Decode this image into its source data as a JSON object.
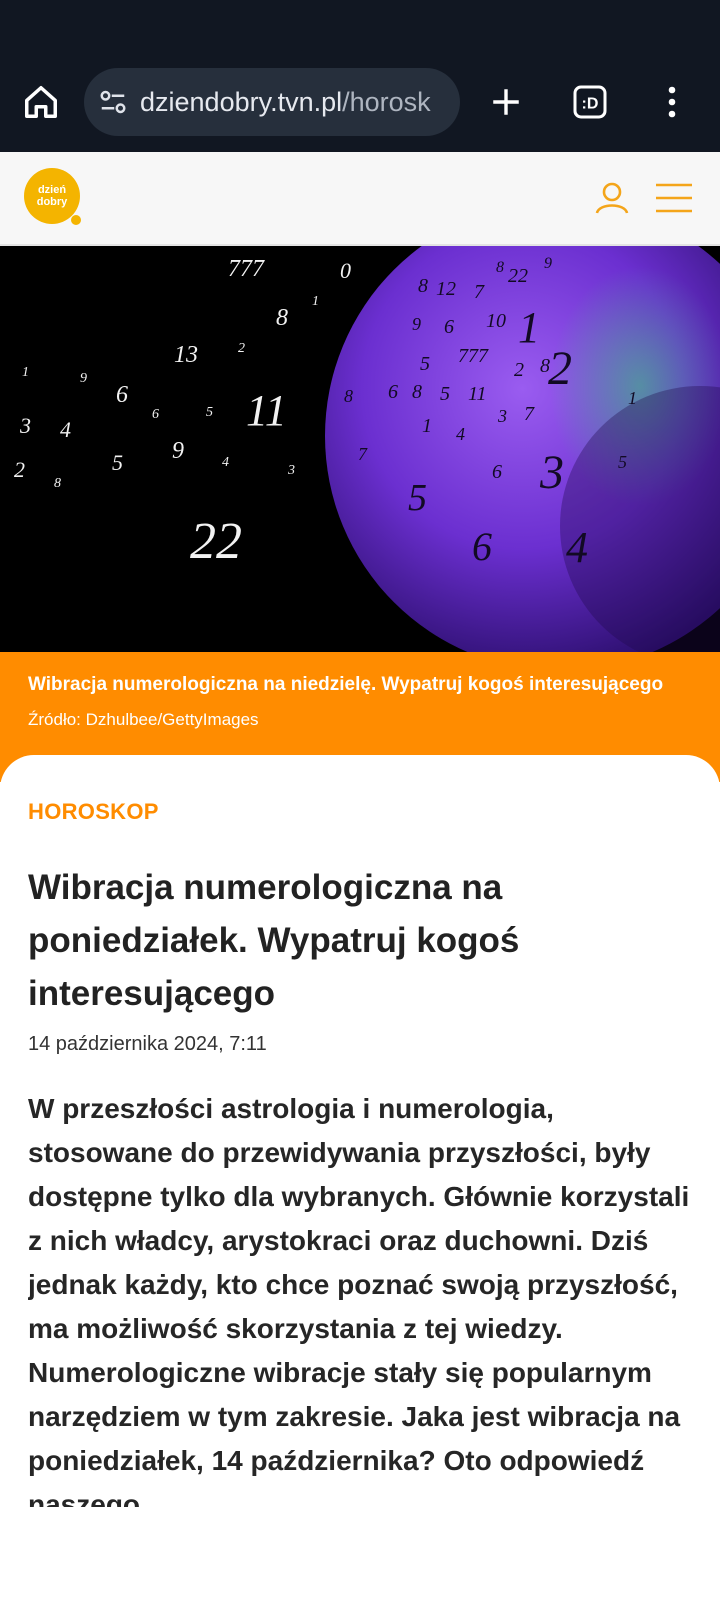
{
  "browser": {
    "url_domain": "dziendobry.tvn.pl",
    "url_path": "/horosk",
    "tab_badge": ":D"
  },
  "site": {
    "logo_line1": "dzień",
    "logo_line2": "dobry",
    "accent_color": "#ff8c00",
    "logo_color": "#f4b400"
  },
  "hero": {
    "numbers": [
      "777",
      "0",
      "8",
      "1",
      "2",
      "13",
      "1",
      "9",
      "6",
      "6",
      "5",
      "11",
      "3",
      "4",
      "2",
      "8",
      "5",
      "9",
      "4",
      "3",
      "22",
      "8",
      "12",
      "7",
      "8",
      "22",
      "9",
      "9",
      "6",
      "10",
      "1",
      "5",
      "777",
      "2",
      "8",
      "2",
      "8",
      "6",
      "8",
      "5",
      "11",
      "3",
      "7",
      "1",
      "1",
      "4",
      "7",
      "6",
      "3",
      "5",
      "6",
      "5",
      "4"
    ]
  },
  "caption": {
    "title": "Wibracja numerologiczna na niedzielę. Wypatruj kogoś interesującego",
    "source": "Źródło: Dzhulbee/GettyImages"
  },
  "article": {
    "category": "HOROSKOP",
    "headline": "Wibracja numerologiczna na poniedziałek. Wypatruj kogoś interesującego",
    "date": "14 października 2024, 7:11",
    "lead": "W przeszłości astrologia i numerologia, stosowane do przewidywania przyszłości, były dostępne tylko dla wybranych. Głównie korzystali z nich władcy, arystokraci oraz duchowni. Dziś jednak każdy, kto chce poznać swoją przyszłość, ma możliwość skorzystania z tej wiedzy. Numerologiczne wibracje stały się popularnym narzędziem w tym zakresie. Jaka jest wibracja na poniedziałek, 14 października? Oto odpowiedź naszego"
  }
}
